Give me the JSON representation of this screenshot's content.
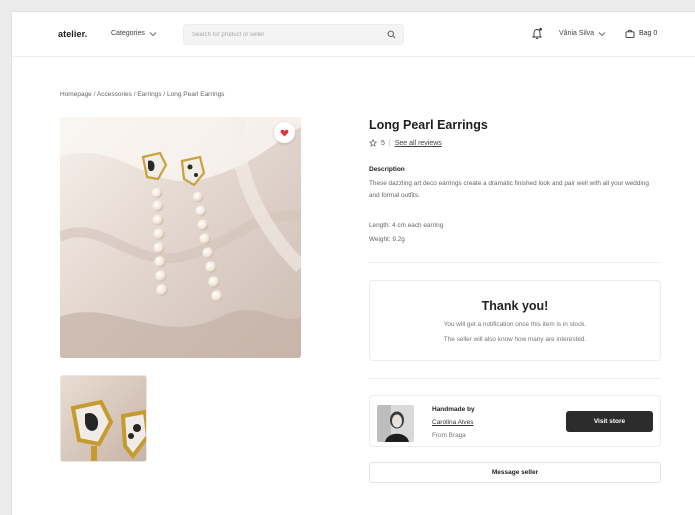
{
  "header": {
    "logo": "atelier.",
    "categories_label": "Categories",
    "search_placeholder": "Search for product or seller",
    "user_name": "Vânia Silva",
    "bag_label": "Bag 0"
  },
  "breadcrumb": {
    "items": [
      "Homepage",
      "Accessories",
      "Earrings",
      "Long Pearl Earrings"
    ],
    "separator": " / "
  },
  "product": {
    "title": "Long Pearl Earrings",
    "rating": "5",
    "reviews_link": "See all reviews",
    "description_heading": "Description",
    "description": "These dazzling art deco earrings create a dramatic finished look and pair well with all your wedding and formal outfits.",
    "length": "Length: 4 cm each earring",
    "weight": "Weight: 9.2g",
    "favorite_icon": "heart-icon",
    "favorite_color": "#d9363e"
  },
  "notice": {
    "title": "Thank you!",
    "line1": "You will get a notification once this item is in stock.",
    "line2": "The seller will also know how many are interested."
  },
  "seller": {
    "label": "Handmade by",
    "name": "Carolina Alves",
    "location": "From Braga",
    "visit_button": "Visit store",
    "message_button": "Message seller"
  },
  "colors": {
    "accent_dark": "#2c2c2c",
    "background": "#ffffff"
  }
}
